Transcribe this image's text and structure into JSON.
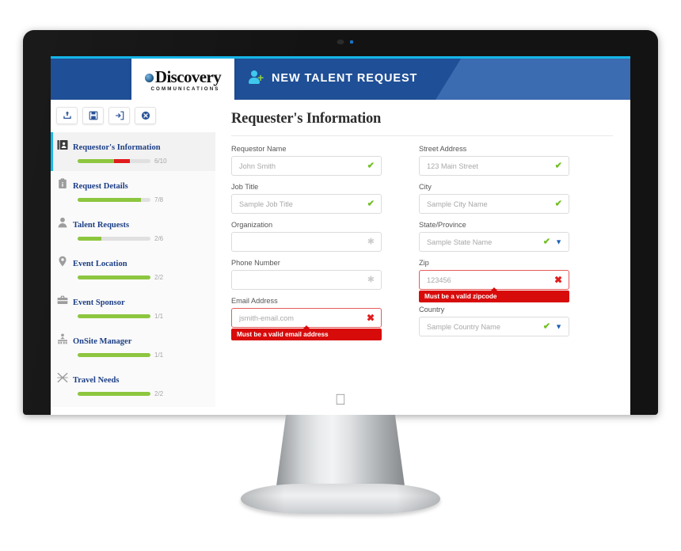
{
  "header": {
    "logo_wordmark": "Discovery",
    "logo_subtext": "COMMUNICATIONS",
    "title": "NEW TALENT REQUEST",
    "icon": "add-user-icon",
    "accent_cyan": "#15b5e8",
    "bg_dark_blue": "#1f4f96",
    "bg_light_blue": "#3b6bb0"
  },
  "toolbar": {
    "buttons": [
      {
        "name": "upload-button",
        "icon": "upload-icon"
      },
      {
        "name": "save-button",
        "icon": "floppy-disk-icon"
      },
      {
        "name": "exit-button",
        "icon": "exit-door-icon"
      },
      {
        "name": "close-button",
        "icon": "close-circle-icon"
      }
    ]
  },
  "sidebar": {
    "items": [
      {
        "label": "Requestor's Information",
        "count": "6/10",
        "green_pct": 50,
        "red_pct": 22,
        "icon": "contact-card-icon",
        "active": true
      },
      {
        "label": "Request Details",
        "count": "7/8",
        "green_pct": 87,
        "red_pct": 0,
        "icon": "clipboard-icon",
        "active": false
      },
      {
        "label": "Talent Requests",
        "count": "2/6",
        "green_pct": 33,
        "red_pct": 0,
        "icon": "person-icon",
        "active": false
      },
      {
        "label": "Event Location",
        "count": "2/2",
        "green_pct": 100,
        "red_pct": 0,
        "icon": "map-pin-icon",
        "active": false
      },
      {
        "label": "Event Sponsor",
        "count": "1/1",
        "green_pct": 100,
        "red_pct": 0,
        "icon": "briefcase-icon",
        "active": false
      },
      {
        "label": "OnSite Manager",
        "count": "1/1",
        "green_pct": 100,
        "red_pct": 0,
        "icon": "manager-podium-icon",
        "active": false
      },
      {
        "label": "Travel Needs",
        "count": "2/2",
        "green_pct": 100,
        "red_pct": 0,
        "icon": "airplane-icon",
        "active": false
      }
    ]
  },
  "main": {
    "page_title": "Requester's Information",
    "left_fields": [
      {
        "label": "Requestor Name",
        "value": "John Smith",
        "state": "valid",
        "adorn": "check"
      },
      {
        "label": "Job Title",
        "value": "Sample Job Title",
        "state": "valid",
        "adorn": "check"
      },
      {
        "label": "Organization",
        "value": "",
        "state": "optional",
        "adorn": "asterisk"
      },
      {
        "label": "Phone Number",
        "value": "",
        "state": "optional",
        "adorn": "asterisk"
      },
      {
        "label": "Email Address",
        "value": "jsmith-email.com",
        "state": "error",
        "adorn": "cross",
        "error": "Must be a valid email address"
      }
    ],
    "right_fields": [
      {
        "label": "Street Address",
        "value": "123 Main Street",
        "state": "valid",
        "adorn": "check"
      },
      {
        "label": "City",
        "value": "Sample City Name",
        "state": "valid",
        "adorn": "check"
      },
      {
        "label": "State/Province",
        "value": "Sample State Name",
        "state": "valid",
        "adorn": "check-chevron"
      },
      {
        "label": "Zip",
        "value": "123456",
        "state": "error",
        "adorn": "cross",
        "error": "Must be a valid zipcode"
      },
      {
        "label": "Country",
        "value": "Sample Country Name",
        "state": "valid",
        "adorn": "check-chevron"
      }
    ]
  },
  "device": {
    "apple_logo": "",
    "brand": "apple-imac"
  },
  "colors": {
    "valid_green": "#6fbe1f",
    "error_red": "#d80b0b",
    "progress_green": "#8dc63f",
    "progress_red": "#e01b1b",
    "nav_label_blue": "#1d3f86",
    "active_accent": "#19b9e8"
  }
}
